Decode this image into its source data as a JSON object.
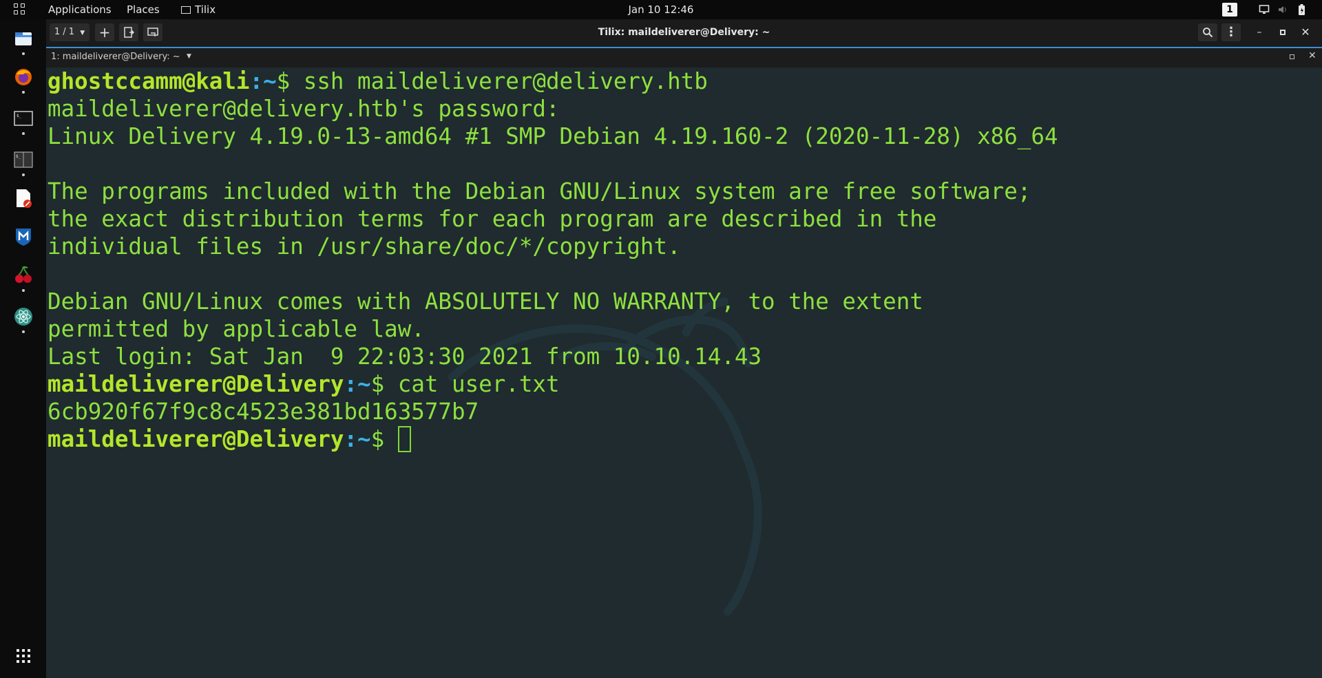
{
  "topbar": {
    "applications": "Applications",
    "places": "Places",
    "app_name": "Tilix",
    "clock": "Jan 10  12:46",
    "workspace": "1"
  },
  "dock": {
    "items": [
      "file-manager-icon",
      "firefox-icon",
      "terminal-icon",
      "terminal-emulator-icon",
      "text-editor-icon",
      "metasploit-icon",
      "cherrytree-icon",
      "atom-icon"
    ]
  },
  "window": {
    "session_counter": "1 / 1",
    "title": "Tilix: maildeliverer@Delivery: ~",
    "terminal_tab": "1: maildeliverer@Delivery: ~"
  },
  "terminal": {
    "l1_user": "ghostccamm@kali",
    "l1_path": "~",
    "l1_cmd": "$ ssh maildeliverer@delivery.htb",
    "l2": "maildeliverer@delivery.htb's password:",
    "l3": "Linux Delivery 4.19.0-13-amd64 #1 SMP Debian 4.19.160-2 (2020-11-28) x86_64",
    "l5": "The programs included with the Debian GNU/Linux system are free software;",
    "l6": "the exact distribution terms for each program are described in the",
    "l7": "individual files in /usr/share/doc/*/copyright.",
    "l9": "Debian GNU/Linux comes with ABSOLUTELY NO WARRANTY, to the extent",
    "l10": "permitted by applicable law.",
    "l11": "Last login: Sat Jan  9 22:03:30 2021 from 10.10.14.43",
    "l12_user": "maildeliverer@Delivery",
    "l12_path": "~",
    "l12_cmd": "$ cat user.txt",
    "l13": "6cb920f67f9c8c4523e381bd163577b7",
    "l14_user": "maildeliverer@Delivery",
    "l14_path": "~",
    "l14_prompt": "$ "
  }
}
